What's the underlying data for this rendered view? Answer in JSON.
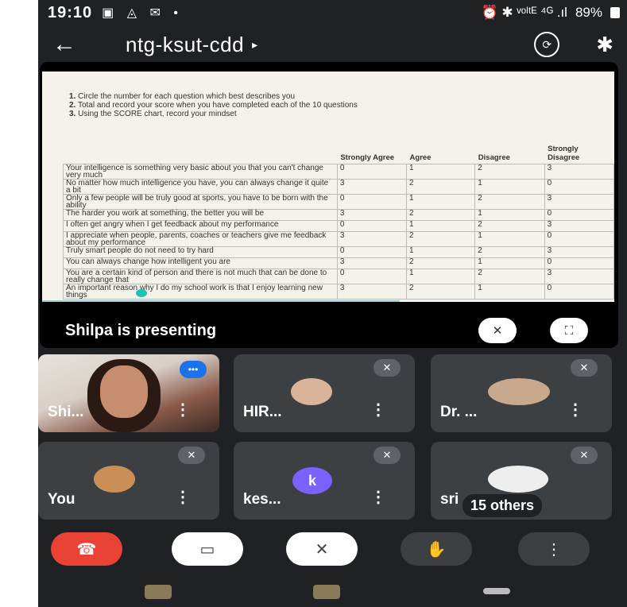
{
  "status": {
    "time": "19:10",
    "left_icons": "▣ ◬ ✉ •",
    "right_icons": "⏰ ✱ ᵛᵒˡᵗᴱ ⁴ᴳ .ıl",
    "battery": "89%"
  },
  "header": {
    "back": "←",
    "meeting_code": "ntg-ksut-cdd",
    "caret": "▸",
    "camera_switch": "⟳",
    "bluetooth": "✱"
  },
  "slide": {
    "instructions": [
      {
        "num": "1.",
        "text": "Circle the number for each question which best describes you"
      },
      {
        "num": "2.",
        "text": "Total and record your score when you have completed each of the 10 questions"
      },
      {
        "num": "3.",
        "text": "Using the SCORE chart, record your mindset"
      }
    ],
    "columns": [
      "Strongly Agree",
      "Agree",
      "Disagree",
      "Strongly Disagree"
    ],
    "rows": [
      {
        "statement": "Your intelligence is something very basic about you that you can't change very much",
        "scores": [
          "0",
          "1",
          "2",
          "3"
        ]
      },
      {
        "statement": "No matter how much intelligence you have, you can always change it quite a bit",
        "scores": [
          "3",
          "2",
          "1",
          "0"
        ]
      },
      {
        "statement": "Only a few people will be truly good at sports, you have to be born with the ability",
        "scores": [
          "0",
          "1",
          "2",
          "3"
        ]
      },
      {
        "statement": "The harder you work at something, the better you will be",
        "scores": [
          "3",
          "2",
          "1",
          "0"
        ]
      },
      {
        "statement": "I often get angry when I get feedback about my performance",
        "scores": [
          "0",
          "1",
          "2",
          "3"
        ]
      },
      {
        "statement": "I appreciate when people, parents, coaches or teachers give me feedback about my performance",
        "scores": [
          "3",
          "2",
          "1",
          "0"
        ]
      },
      {
        "statement": "Truly smart people do not need to try hard",
        "scores": [
          "0",
          "1",
          "2",
          "3"
        ]
      },
      {
        "statement": "You can always change how intelligent you are",
        "scores": [
          "3",
          "2",
          "1",
          "0"
        ]
      },
      {
        "statement": "You are a certain kind of person and there is not much that can be done to really change that",
        "scores": [
          "0",
          "1",
          "2",
          "3"
        ]
      },
      {
        "statement": "An important reason why I do my school work is that I enjoy learning new things",
        "scores": [
          "3",
          "2",
          "1",
          "0"
        ]
      }
    ]
  },
  "presenting": {
    "label": "Shilpa is presenting",
    "unpin_icon": "✕",
    "fullscreen_icon": "⛶"
  },
  "participants": [
    {
      "name": "Shi...",
      "more": "⋮",
      "badge": "•••"
    },
    {
      "name": "HIR...",
      "more": "⋮",
      "mute": "✕"
    },
    {
      "name": "Dr. ...",
      "more": "⋮",
      "mute": "✕"
    },
    {
      "name": "You",
      "more": "⋮",
      "mute": "✕"
    },
    {
      "name": "kes...",
      "more": "⋮",
      "mute": "✕",
      "initial": "k"
    },
    {
      "name": "sri",
      "more": "",
      "mute": "✕",
      "others": "15 others"
    }
  ],
  "controls": {
    "end_call": "☎",
    "camera_off": "▭",
    "mic_off": "✕",
    "raise_hand": "✋",
    "more": "⋮"
  },
  "colors": {
    "end_call": "#ea4335",
    "kes_avatar": "#7b61ff",
    "tile_bg": "#3c4043",
    "bg": "#202124"
  }
}
